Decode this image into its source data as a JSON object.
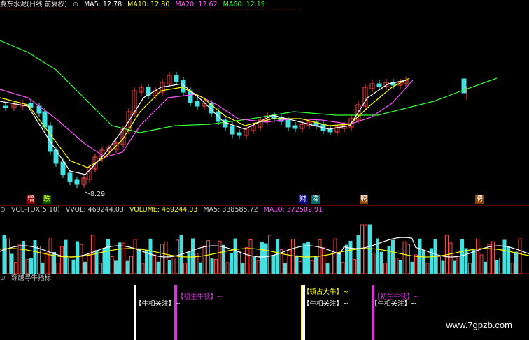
{
  "main_header": {
    "title": "冀东水泥(日线 前复权)",
    "ma5": "MA5: 12.78",
    "ma10": "MA10: 12.80",
    "ma20": "MA20: 12.62",
    "ma60": "MA60: 12.19",
    "colors": {
      "ma5": "#ffffff",
      "ma10": "#ffff00",
      "ma20": "#ff55ff",
      "ma60": "#33ff33"
    }
  },
  "low_label": "8.29",
  "events": [
    {
      "text": "增",
      "bg": "#880000",
      "fg": "#ffffff"
    },
    {
      "text": "跌",
      "bg": "#005500",
      "fg": "#ffff00"
    },
    {
      "text": "财",
      "bg": "#000088",
      "fg": "#ffffff"
    },
    {
      "text": "滞",
      "bg": "#006666",
      "fg": "#ffffff"
    },
    {
      "text": "聘",
      "bg": "#884400",
      "fg": "#ffffff"
    },
    {
      "text": "聘",
      "bg": "#884400",
      "fg": "#ffffff"
    }
  ],
  "volume_header": {
    "name": "VOL-TDX(5,10)",
    "vvol": "VVOL: 469244.03",
    "volume": "VOLUME: 469244.03",
    "ma5": "MA5: 338585.72",
    "ma10": "MA10: 372502.91"
  },
  "indicator_header": {
    "name": "穿越寻牛指标"
  },
  "signals": [
    {
      "label": "【牛相关注】~",
      "color": "#ffffff"
    },
    {
      "label": "【初生牛犊】~",
      "color": "#dd33dd"
    },
    {
      "label": "【镇占大牛】~",
      "color": "#ffff00"
    },
    {
      "label": "【牛相关注】~",
      "color": "#ffffff"
    },
    {
      "label": "【初生牛犊】~",
      "color": "#dd33dd"
    },
    {
      "label": "【牛相关注】~",
      "color": "#ffffff"
    }
  ],
  "watermark": "www.7gpzb.com",
  "chart_data": {
    "type": "candlestick",
    "price_low_marked": 8.29,
    "moving_averages": {
      "MA5": 12.78,
      "MA10": 12.8,
      "MA20": 12.62,
      "MA60": 12.19
    },
    "volume_latest": 469244.03,
    "volume_ma5": 338585.72,
    "volume_ma10": 372502.91
  }
}
